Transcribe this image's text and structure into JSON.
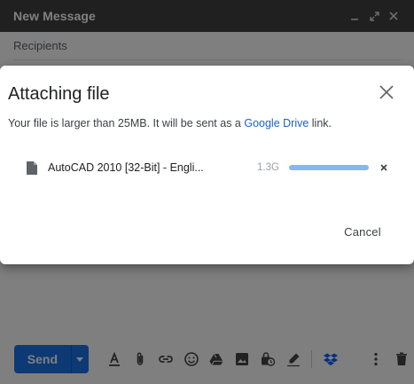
{
  "compose": {
    "title": "New Message",
    "recipients_placeholder": "Recipients",
    "send_label": "Send",
    "toolbar_icons": [
      "format-text-icon",
      "attach-icon",
      "link-icon",
      "emoji-icon",
      "drive-icon",
      "photo-icon",
      "confidential-icon",
      "signature-icon",
      "dropbox-icon",
      "more-options-icon",
      "trash-icon"
    ]
  },
  "dialog": {
    "title": "Attaching file",
    "message_prefix": "Your file is larger than 25MB. It will be sent as a ",
    "message_link": "Google Drive",
    "message_suffix": " link.",
    "file": {
      "name": "AutoCAD 2010 [32-Bit] - Engli...",
      "size": "1.3G",
      "progress": 1.0
    },
    "cancel_label": "Cancel"
  },
  "colors": {
    "titlebar": "#404040",
    "send_button": "#1a73e8",
    "link": "#1a62c9",
    "dropbox": "#0061fe",
    "progress": "#8ab4f8"
  }
}
